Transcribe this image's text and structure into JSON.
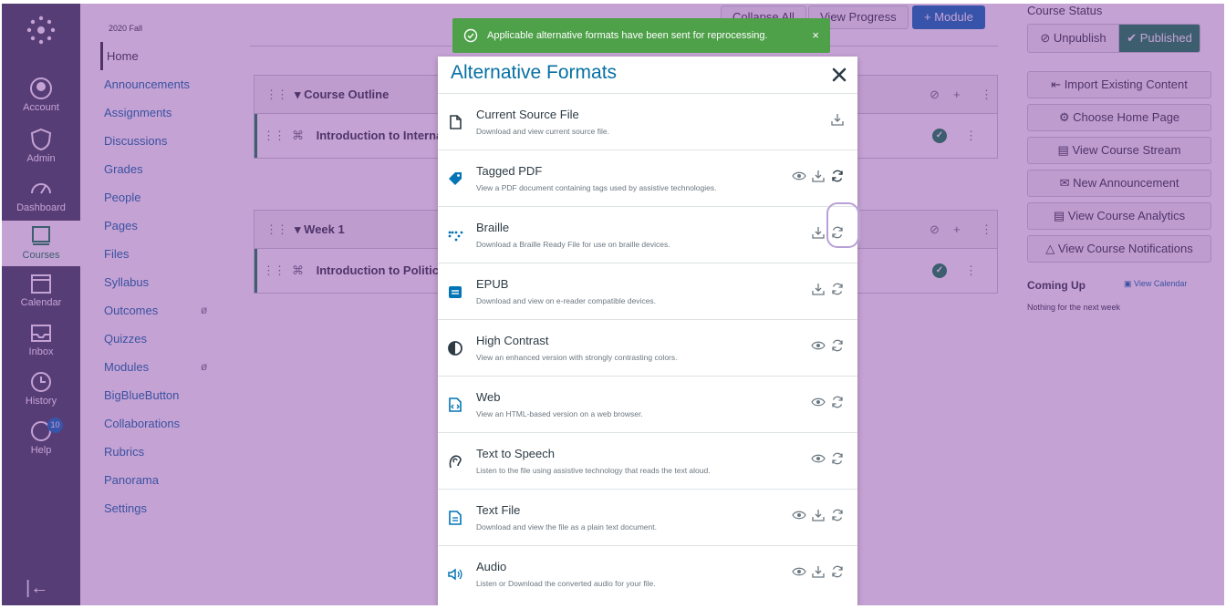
{
  "global_nav": {
    "items": [
      {
        "label": "Account",
        "icon": "account-icon"
      },
      {
        "label": "Admin",
        "icon": "admin-icon"
      },
      {
        "label": "Dashboard",
        "icon": "dashboard-icon"
      },
      {
        "label": "Courses",
        "icon": "courses-icon"
      },
      {
        "label": "Calendar",
        "icon": "calendar-icon"
      },
      {
        "label": "Inbox",
        "icon": "inbox-icon"
      },
      {
        "label": "History",
        "icon": "history-icon"
      },
      {
        "label": "Help",
        "icon": "help-icon",
        "badge": "10"
      }
    ],
    "active": "Courses"
  },
  "course_nav": {
    "term": "2020 Fall",
    "items": [
      {
        "label": "Home"
      },
      {
        "label": "Announcements"
      },
      {
        "label": "Assignments"
      },
      {
        "label": "Discussions"
      },
      {
        "label": "Grades"
      },
      {
        "label": "People"
      },
      {
        "label": "Pages"
      },
      {
        "label": "Files"
      },
      {
        "label": "Syllabus"
      },
      {
        "label": "Outcomes",
        "hidden_icon": "ø"
      },
      {
        "label": "Quizzes"
      },
      {
        "label": "Modules",
        "hidden_icon": "ø"
      },
      {
        "label": "BigBlueButton"
      },
      {
        "label": "Collaborations"
      },
      {
        "label": "Rubrics"
      },
      {
        "label": "Panorama"
      },
      {
        "label": "Settings"
      }
    ],
    "active": "Home"
  },
  "toolbar": {
    "collapse_all": "Collapse All",
    "view_progress": "View Progress",
    "add_module": "+ Module"
  },
  "modules": [
    {
      "title": "Course Outline",
      "item": "Introduction to Internat"
    },
    {
      "title": "Week 1",
      "item": "Introduction to Political"
    }
  ],
  "sidebar": {
    "course_status_title": "Course Status",
    "unpublish": "Unpublish",
    "published": "Published",
    "buttons": [
      "Import Existing Content",
      "Choose Home Page",
      "View Course Stream",
      "New Announcement",
      "View Course Analytics",
      "View Course Notifications"
    ],
    "coming_up": "Coming Up",
    "view_calendar": "View Calendar",
    "coming_up_empty": "Nothing for the next week"
  },
  "toast": {
    "message": "Applicable alternative formats have been sent for reprocessing.",
    "close": "×"
  },
  "dialog": {
    "title": "Alternative Formats",
    "formats": [
      {
        "name": "Current Source File",
        "desc": "Download and view current source file.",
        "icon": "file-icon",
        "actions": [
          "download"
        ]
      },
      {
        "name": "Tagged PDF",
        "desc": "View a PDF document containing tags used by assistive technologies.",
        "icon": "tag-icon",
        "actions": [
          "view",
          "download",
          "reprocess"
        ]
      },
      {
        "name": "Braille",
        "desc": "Download a Braille Ready File for use on braille devices.",
        "icon": "braille-icon",
        "actions": [
          "download",
          "reprocess"
        ]
      },
      {
        "name": "EPUB",
        "desc": "Download and view on e-reader compatible devices.",
        "icon": "epub-icon",
        "actions": [
          "download",
          "reprocess"
        ]
      },
      {
        "name": "High Contrast",
        "desc": "View an enhanced version with strongly contrasting colors.",
        "icon": "contrast-icon",
        "actions": [
          "view",
          "reprocess"
        ]
      },
      {
        "name": "Web",
        "desc": "View an HTML-based version on a web browser.",
        "icon": "web-icon",
        "actions": [
          "view",
          "reprocess"
        ]
      },
      {
        "name": "Text to Speech",
        "desc": "Listen to the file using assistive technology that reads the text aloud.",
        "icon": "speech-icon",
        "actions": [
          "view",
          "reprocess"
        ]
      },
      {
        "name": "Text File",
        "desc": "Download and view the file as a plain text document.",
        "icon": "text-file-icon",
        "actions": [
          "view",
          "download",
          "reprocess"
        ]
      },
      {
        "name": "Audio",
        "desc": "Listen or Download the converted audio for your file.",
        "icon": "audio-icon",
        "actions": [
          "view",
          "download",
          "reprocess"
        ]
      }
    ]
  },
  "colors": {
    "overlay": "#7a2c9c",
    "link": "#0770a3",
    "success": "#0b874b",
    "toast": "#4ea049",
    "global_nav": "#394b58"
  }
}
